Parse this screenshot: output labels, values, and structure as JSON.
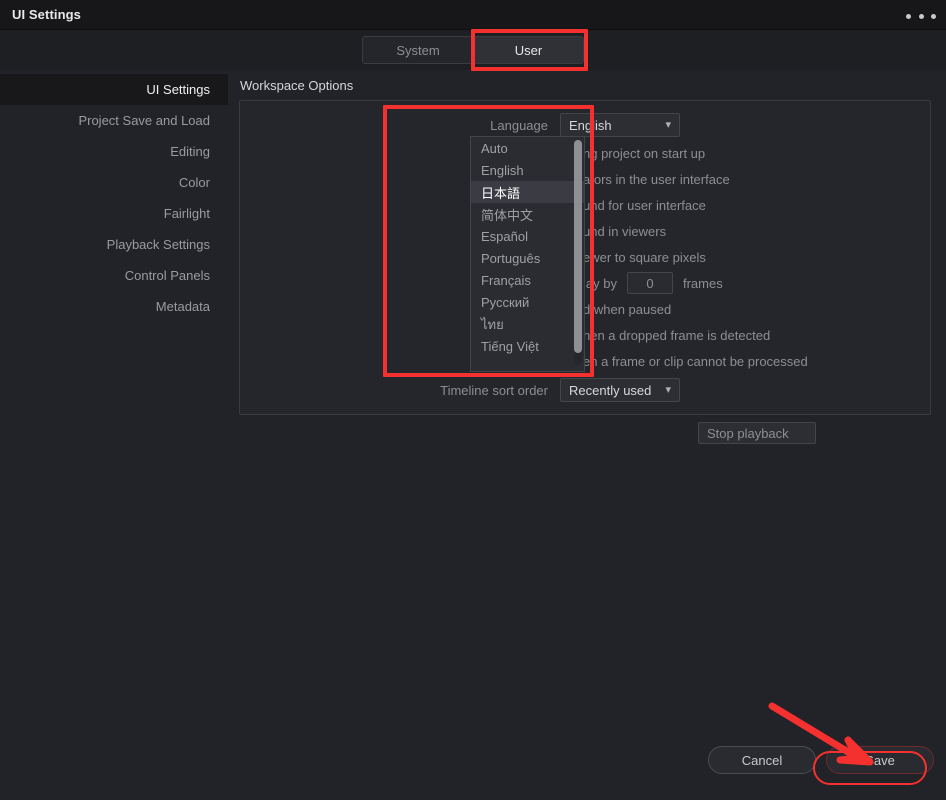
{
  "window": {
    "title": "UI Settings",
    "menu_icon": "ellipsis-icon"
  },
  "tabs": [
    {
      "label": "System",
      "active": false
    },
    {
      "label": "User",
      "active": true
    }
  ],
  "sidebar": {
    "items": [
      {
        "label": "UI Settings",
        "active": true
      },
      {
        "label": "Project Save and Load",
        "active": false
      },
      {
        "label": "Editing",
        "active": false
      },
      {
        "label": "Color",
        "active": false
      },
      {
        "label": "Fairlight",
        "active": false
      },
      {
        "label": "Playback Settings",
        "active": false
      },
      {
        "label": "Control Panels",
        "active": false
      },
      {
        "label": "Metadata",
        "active": false
      }
    ]
  },
  "main": {
    "section_title": "Workspace Options",
    "language": {
      "label": "Language",
      "value": "English",
      "chevron": "chevron-down-icon"
    },
    "options": [
      {
        "text": "ng project on start up",
        "type": "checkbox"
      },
      {
        "text": "ators in the user interface",
        "type": "checkbox"
      },
      {
        "text": "und for user interface",
        "type": "checkbox"
      },
      {
        "text": "und in viewers",
        "type": "checkbox"
      },
      {
        "text": "ewer to square pixels",
        "type": "checkbox"
      },
      {
        "text": "lay by",
        "type": "checkbox-number",
        "number_value": "0",
        "number_suffix": "frames"
      },
      {
        "text": "d when paused",
        "type": "checkbox"
      },
      {
        "text": "hen a dropped frame is detected",
        "type": "checkbox"
      },
      {
        "text": "en a frame or clip cannot be processed",
        "type": "checkbox"
      }
    ],
    "hidden_combo_value": "Stop playback",
    "timeline_sort": {
      "label": "Timeline sort order",
      "value": "Recently used",
      "chevron": "chevron-down-icon"
    }
  },
  "language_dropdown": {
    "open": true,
    "items": [
      {
        "label": "Auto",
        "highlighted": false
      },
      {
        "label": "English",
        "highlighted": false
      },
      {
        "label": "日本語",
        "highlighted": true
      },
      {
        "label": "简体中文",
        "highlighted": false
      },
      {
        "label": "Español",
        "highlighted": false
      },
      {
        "label": "Português",
        "highlighted": false
      },
      {
        "label": "Français",
        "highlighted": false
      },
      {
        "label": "Русский",
        "highlighted": false
      },
      {
        "label": "ไทย",
        "highlighted": false
      },
      {
        "label": "Tiếng Việt",
        "highlighted": false
      }
    ]
  },
  "footer": {
    "cancel_label": "Cancel",
    "save_label": "Save"
  },
  "annotations": {
    "color": "#f4312f",
    "boxes": [
      "user-tab",
      "language-dropdown",
      "save-button"
    ],
    "arrow": "arrow-pointing-to-save"
  }
}
